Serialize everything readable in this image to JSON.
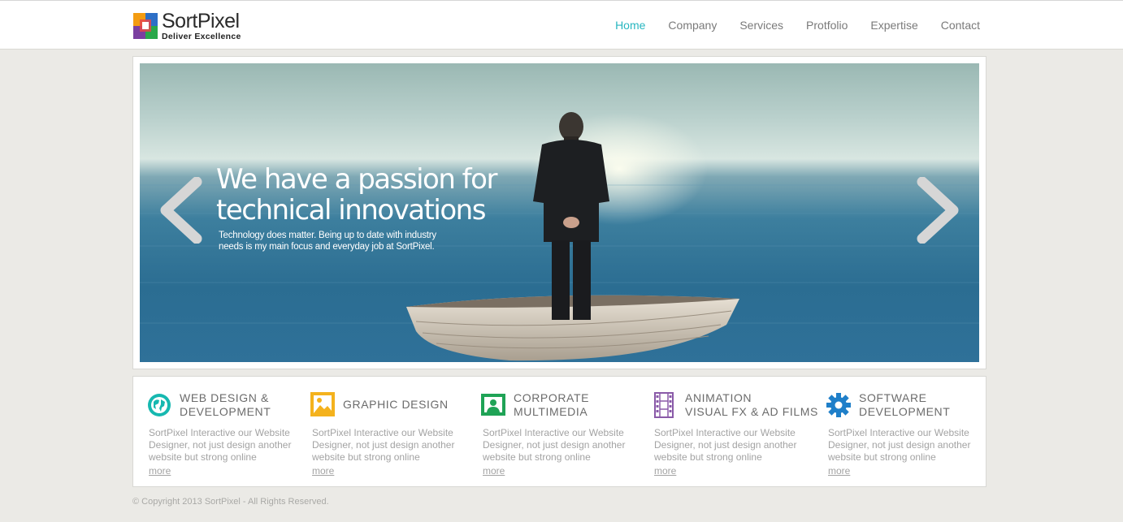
{
  "brand": {
    "name": "SortPixel",
    "tagline": "Deliver Excellence",
    "colors": {
      "accent": "#27b6c0",
      "logo_blue": "#2d6fc6",
      "logo_orange": "#f39c12",
      "logo_green": "#2aa84a",
      "logo_purple": "#7b3fa0"
    }
  },
  "nav": {
    "items": [
      {
        "label": "Home",
        "active": true
      },
      {
        "label": "Company"
      },
      {
        "label": "Services"
      },
      {
        "label": "Protfolio"
      },
      {
        "label": "Expertise"
      },
      {
        "label": "Contact"
      }
    ]
  },
  "slider": {
    "headline_line1": "We have a passion for",
    "headline_line2": "technical innovations",
    "subtext_line1": "Technology does matter. Being up to date with industry",
    "subtext_line2": "needs is my main focus and everyday job at SortPixel.",
    "prev_icon": "chevron-left-icon",
    "next_icon": "chevron-right-icon"
  },
  "services": [
    {
      "title_line1": "WEB DESIGN &",
      "title_line2": "DEVELOPMENT",
      "icon": "globe-icon",
      "color": "#16b8b0",
      "desc": "SortPixel Interactive our Website Designer, not just design another website but strong online",
      "more": "more"
    },
    {
      "title_line1": "GRAPHIC DESIGN",
      "title_line2": "",
      "icon": "image-icon",
      "color": "#f4b21d",
      "desc": "SortPixel Interactive our Website Designer, not just design another website but strong online",
      "more": "more"
    },
    {
      "title_line1": "CORPORATE",
      "title_line2": "MULTIMEDIA",
      "icon": "user-card-icon",
      "color": "#1fa356",
      "desc": "SortPixel Interactive our Website Designer, not just design another website but strong online",
      "more": "more"
    },
    {
      "title_line1": "ANIMATION",
      "title_line2": "VISUAL FX & AD FILMS",
      "icon": "film-icon",
      "color": "#8a5aa8",
      "desc": "SortPixel Interactive our Website Designer, not just design another website but strong online",
      "more": "more"
    },
    {
      "title_line1": "SOFTWARE",
      "title_line2": "DEVELOPMENT",
      "icon": "gear-icon",
      "color": "#1f7fc9",
      "desc": "SortPixel Interactive our Website Designer, not just design another website but strong online",
      "more": "more"
    }
  ],
  "footer": {
    "copyright": "© Copyright 2013 SortPixel - All Rights Reserved."
  }
}
